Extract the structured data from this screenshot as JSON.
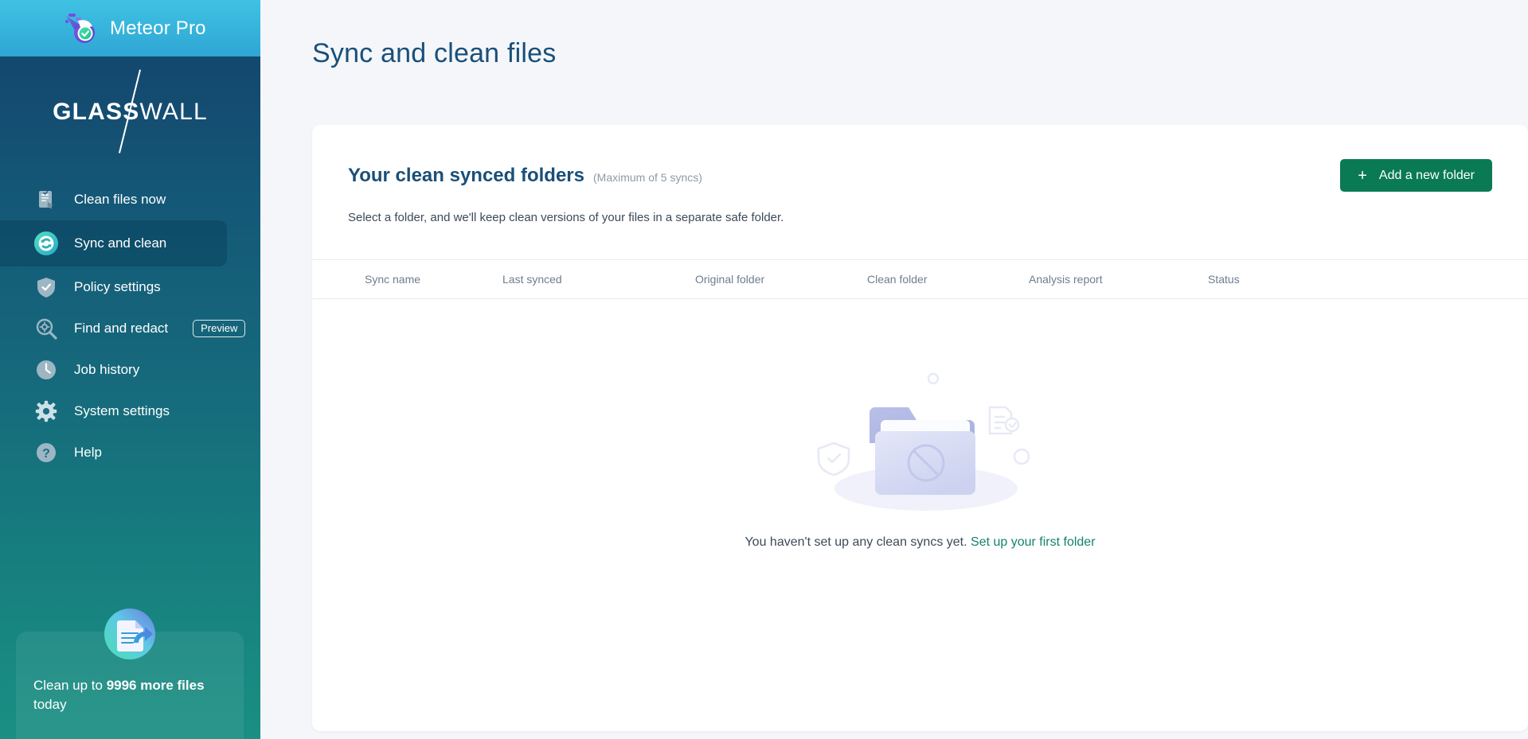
{
  "brand": {
    "product_name": "Meteor Pro",
    "logo_icon": "meteor-check-icon",
    "company_first": "GLASS",
    "company_second": "WALL"
  },
  "sidebar": {
    "items": [
      {
        "label": "Clean files now",
        "icon": "document-check-cursor-icon",
        "active": false
      },
      {
        "label": "Sync and clean",
        "icon": "sync-refresh-icon",
        "active": true
      },
      {
        "label": "Policy settings",
        "icon": "shield-check-icon",
        "active": false
      },
      {
        "label": "Find and redact",
        "icon": "magnifier-gear-icon",
        "active": false,
        "badge": "Preview"
      },
      {
        "label": "Job history",
        "icon": "clock-icon",
        "active": false
      },
      {
        "label": "System settings",
        "icon": "gear-icon",
        "active": false
      },
      {
        "label": "Help",
        "icon": "question-circle-icon",
        "active": false
      }
    ],
    "promo": {
      "icon": "document-refresh-icon",
      "text_before": "Clean up to ",
      "count": "9996 more files",
      "text_after": " today"
    }
  },
  "page": {
    "title": "Sync and clean files"
  },
  "card": {
    "title": "Your clean synced folders",
    "subtitle": "(Maximum of 5 syncs)",
    "description": "Select a folder, and we'll keep clean versions of your files in a separate safe folder.",
    "add_button": {
      "label": "Add a new folder",
      "icon": "plus-icon",
      "color": "#0a7a54"
    },
    "table": {
      "columns": [
        "Sync name",
        "Last synced",
        "Original folder",
        "Clean folder",
        "Analysis report",
        "Status"
      ],
      "rows": []
    },
    "empty_state": {
      "illustration": "folder-blocked-icon",
      "message": "You haven't set up any clean syncs yet.",
      "link_label": "Set up your first folder",
      "link_color": "#13836f"
    }
  },
  "colors": {
    "sidebar_top": "#14496f",
    "sidebar_bottom": "#1a8f83",
    "brandbar": "#2fa6d4",
    "page_background": "#f4f6fa",
    "heading": "#1a4f79",
    "accent_green": "#0a7a54"
  }
}
